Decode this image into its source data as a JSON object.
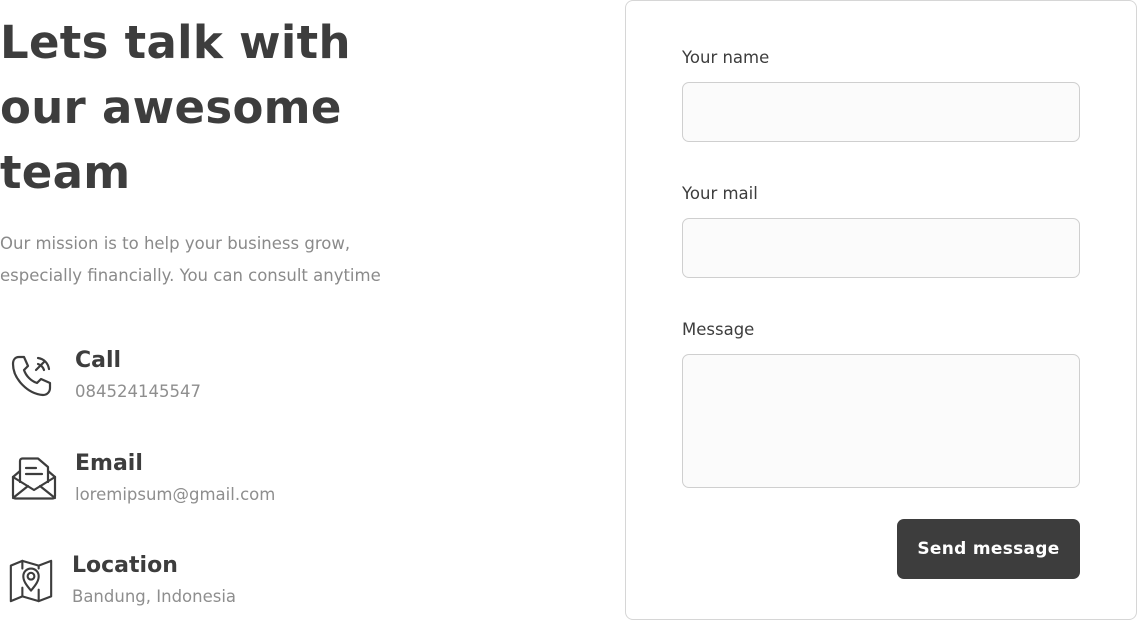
{
  "hero": {
    "title_lines": [
      "Lets talk with",
      "our awesome",
      "team"
    ],
    "subtitle_lines": [
      "Our mission is to help your business grow,",
      "especially financially. You can consult anytime"
    ]
  },
  "contacts": [
    {
      "icon": "phone-icon",
      "title": "Call",
      "value": "084524145547"
    },
    {
      "icon": "envelope-icon",
      "title": "Email",
      "value": "loremipsum@gmail.com"
    },
    {
      "icon": "map-pin-icon",
      "title": "Location",
      "value": "Bandung, Indonesia"
    }
  ],
  "form": {
    "name_label": "Your name",
    "name_value": "",
    "mail_label": "Your mail",
    "mail_value": "",
    "message_label": "Message",
    "message_value": "",
    "submit_label": "Send message"
  },
  "colors": {
    "text_dark": "#3d3d3d",
    "text_muted": "#8a8a8a",
    "button_bg": "#3d3d3d",
    "input_bg": "#fbfbfb",
    "border": "#d6d6d6"
  }
}
